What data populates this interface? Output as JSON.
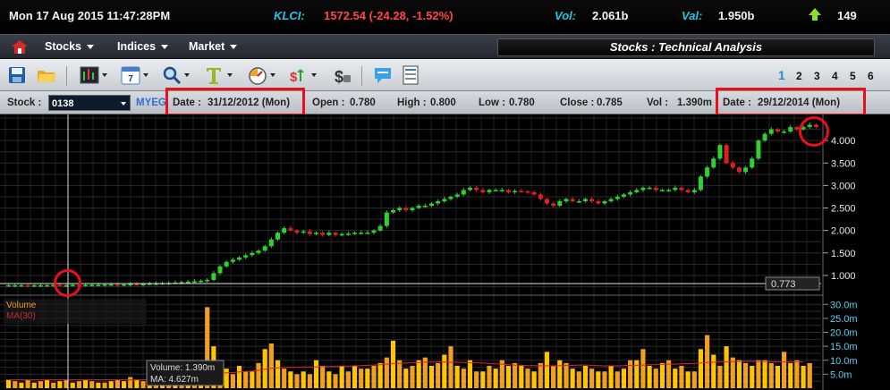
{
  "status": {
    "datetime": "Mon 17 Aug 2015   11:47:28PM",
    "index_label": "KLCI:",
    "index_value": "1572.54 (-24.28, -1.52%)",
    "vol_label": "Vol:",
    "vol_value": "2.061b",
    "val_label": "Val:",
    "val_value": "1.950b",
    "advances": "149",
    "colors": {
      "label": "#26c6e8",
      "down": "#ff4646",
      "up": "#8de02a"
    }
  },
  "menu": {
    "items": [
      {
        "label": "Stocks"
      },
      {
        "label": "Indices"
      },
      {
        "label": "Market"
      }
    ],
    "panel_title": "Stocks : Technical Analysis"
  },
  "toolbar": {
    "icons": [
      "save-icon",
      "open-folder-icon",
      "chart-style-icon",
      "calendar-icon",
      "zoom-icon",
      "text-tool-icon",
      "gauge-icon",
      "indicator-icon",
      "money-icon",
      "comment-icon",
      "report-icon"
    ],
    "calendar_day": "7",
    "pages": [
      "1",
      "2",
      "3",
      "4",
      "5",
      "6"
    ],
    "active_page": "1"
  },
  "info": {
    "stock_label": "Stock :",
    "stock_code": "0138",
    "stock_name": "MYEG",
    "start_date_label": "Date :",
    "start_date": "31/12/2012 (Mon)",
    "open_label": "Open :",
    "open": "0.780",
    "high_label": "High :",
    "high": "0.800",
    "low_label": "Low :",
    "low": "0.780",
    "close_label": "Close :",
    "close": "0.785",
    "vol_label": "Vol :",
    "vol": "1.390m",
    "end_date_label": "Date :",
    "end_date": "29/12/2014 (Mon)"
  },
  "chart_data": {
    "type": "candlestick",
    "price_axis": {
      "ticks": [
        "1.000",
        "1.500",
        "2.000",
        "2.500",
        "3.000",
        "3.500",
        "4.000"
      ],
      "ylim": [
        0.6,
        4.5
      ]
    },
    "cursor_price_label": "0.773",
    "volume_axis": {
      "ticks": [
        "5.0m",
        "10.0m",
        "15.0m",
        "20.0m",
        "25.0m",
        "30.0m"
      ],
      "ylim": [
        0,
        32
      ]
    },
    "volume_legend": {
      "title": "Volume",
      "ma": "MA(30)"
    },
    "cursor_tooltip": {
      "volume": "Volume: 1.390m",
      "ma": "MA: 4.627m"
    },
    "price_closes": [
      0.78,
      0.78,
      0.78,
      0.77,
      0.78,
      0.78,
      0.78,
      0.79,
      0.78,
      0.78,
      0.79,
      0.78,
      0.79,
      0.79,
      0.79,
      0.8,
      0.8,
      0.79,
      0.8,
      0.81,
      0.8,
      0.81,
      0.82,
      0.82,
      0.83,
      0.83,
      0.84,
      0.85,
      0.86,
      0.87,
      0.88,
      0.9,
      1.05,
      1.2,
      1.3,
      1.35,
      1.4,
      1.45,
      1.5,
      1.55,
      1.65,
      1.8,
      1.95,
      2.05,
      2.0,
      1.95,
      1.98,
      1.92,
      1.95,
      1.9,
      1.95,
      1.9,
      1.92,
      1.93,
      1.95,
      1.95,
      1.95,
      2.0,
      2.1,
      2.4,
      2.45,
      2.5,
      2.45,
      2.5,
      2.55,
      2.55,
      2.6,
      2.65,
      2.7,
      2.75,
      2.8,
      2.9,
      2.95,
      2.9,
      2.85,
      2.9,
      2.9,
      2.9,
      2.85,
      2.88,
      2.87,
      2.85,
      2.8,
      2.7,
      2.6,
      2.55,
      2.65,
      2.7,
      2.65,
      2.65,
      2.7,
      2.65,
      2.6,
      2.65,
      2.7,
      2.75,
      2.8,
      2.85,
      2.9,
      2.95,
      2.95,
      2.9,
      2.9,
      2.9,
      2.95,
      2.9,
      2.85,
      2.9,
      3.2,
      3.4,
      3.6,
      3.9,
      3.5,
      3.4,
      3.3,
      3.4,
      3.6,
      4.0,
      4.15,
      4.25,
      4.2,
      4.2,
      4.3,
      4.25,
      4.3,
      4.35,
      4.3
    ],
    "volumes": [
      3,
      2.5,
      2,
      3,
      2,
      2.5,
      3,
      2,
      2.5,
      3,
      2,
      2.5,
      3,
      2.5,
      2,
      2,
      2.5,
      3,
      2.5,
      4,
      3,
      2.5,
      3,
      3.5,
      4,
      3.5,
      3.5,
      4,
      4,
      5,
      6,
      29,
      15,
      9,
      7,
      5,
      8,
      6,
      6,
      9,
      14,
      16,
      10,
      7,
      6,
      5,
      6,
      5,
      10,
      8,
      6,
      5,
      8,
      6,
      8,
      7,
      7,
      8,
      9,
      11,
      17,
      10,
      7,
      8,
      10,
      11,
      8,
      9,
      12,
      15,
      8,
      7,
      10,
      6,
      6,
      8,
      7,
      10,
      8,
      9,
      8,
      7,
      6,
      9,
      13,
      8,
      10,
      9,
      7,
      6,
      8,
      7,
      6,
      6,
      8,
      6,
      7,
      10,
      10,
      14,
      8,
      7,
      9,
      10,
      7,
      8,
      6,
      6,
      14,
      19,
      12,
      8,
      15,
      11,
      10,
      9,
      8,
      10,
      10,
      9,
      8,
      13,
      9,
      10,
      8,
      9
    ],
    "ma_values": [
      3,
      3,
      3,
      3,
      3,
      3,
      3,
      3,
      3,
      3,
      3,
      3,
      3,
      3,
      3,
      3,
      3,
      3,
      3,
      3,
      3,
      3,
      3,
      3.2,
      3.3,
      3.4,
      3.4,
      3.5,
      3.5,
      3.6,
      3.8,
      4.5,
      5,
      5.3,
      5.5,
      5.6,
      5.8,
      6,
      6.1,
      6.4,
      6.8,
      7.1,
      7.3,
      7.4,
      7.5,
      7.5,
      7.6,
      7.6,
      7.6,
      7.7,
      7.8,
      7.8,
      7.9,
      7.9,
      8,
      8.1,
      8.2,
      8.3,
      8.4,
      8.6,
      8.8,
      8.9,
      9,
      9.1,
      9.2,
      9.3,
      9.3,
      9.4,
      9.4,
      9.3,
      9.3,
      9.2,
      9.1,
      9.1,
      9,
      8.9,
      8.7,
      8.6,
      8.4,
      8.3,
      8.2,
      8.1,
      8.1,
      8,
      8,
      8,
      8.1,
      8.2,
      8.2,
      8.3,
      8.3,
      8.2,
      8.1,
      8,
      8,
      8,
      8.1,
      8.2,
      8.2,
      8.3,
      8.4,
      8.4,
      8.5,
      8.6,
      8.6,
      8.7,
      8.8,
      8.9,
      9,
      9.2,
      9.3,
      9.4,
      9.4,
      9.5,
      9.5,
      9.6,
      9.6,
      9.5,
      9.5,
      9.5,
      9.4,
      9.4,
      9.4,
      9.4,
      9.4
    ]
  }
}
